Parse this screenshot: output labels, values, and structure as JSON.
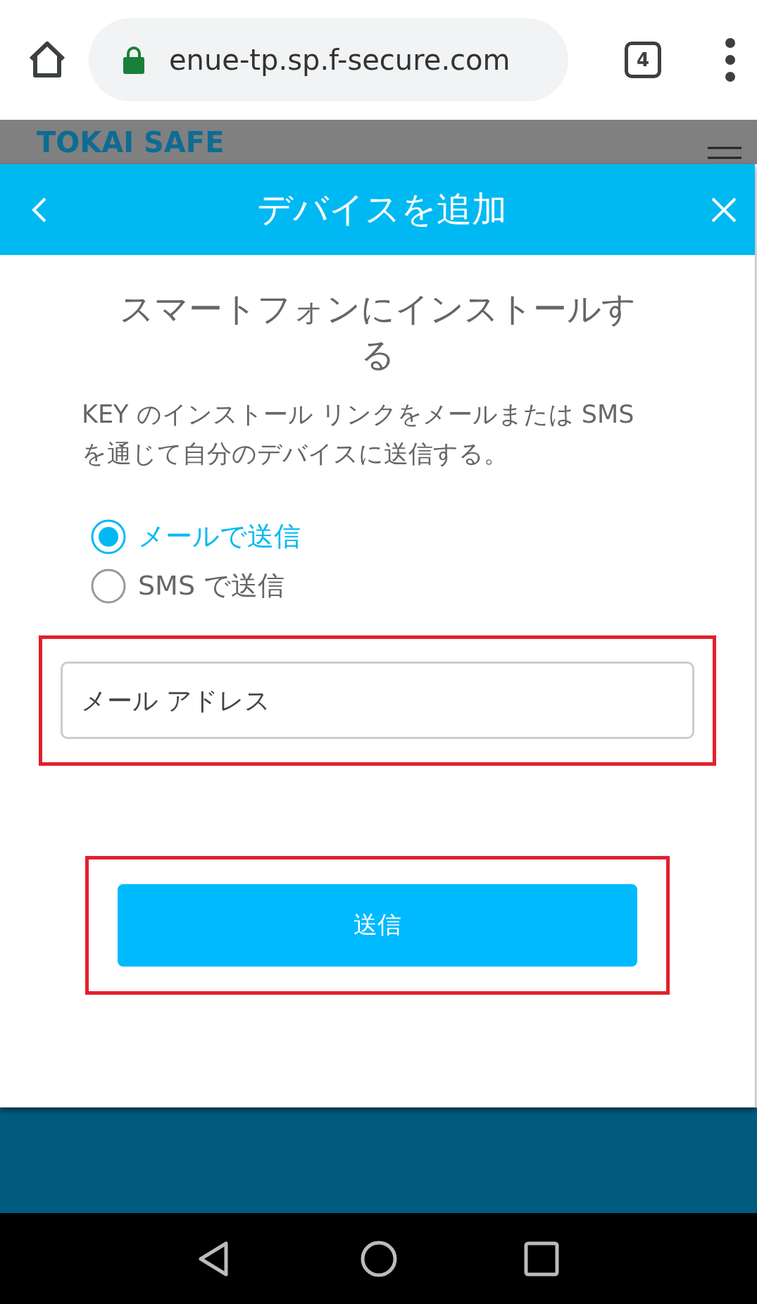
{
  "browser": {
    "url": "enue-tp.sp.f-secure.com",
    "tab_count": "4"
  },
  "site": {
    "logo": "TOKAI SAFE"
  },
  "dialog": {
    "title": "デバイスを追加",
    "heading": "スマートフォンにインストールする",
    "description": "KEY のインストール リンクをメールまたは SMS を通じて自分のデバイスに送信する。",
    "options": [
      {
        "label": "メールで送信",
        "selected": true
      },
      {
        "label": "SMS で送信",
        "selected": false
      }
    ],
    "email_field": {
      "placeholder": "メール アドレス",
      "highlighted": true
    },
    "send_button": {
      "label": "送信",
      "highlighted": true
    }
  }
}
